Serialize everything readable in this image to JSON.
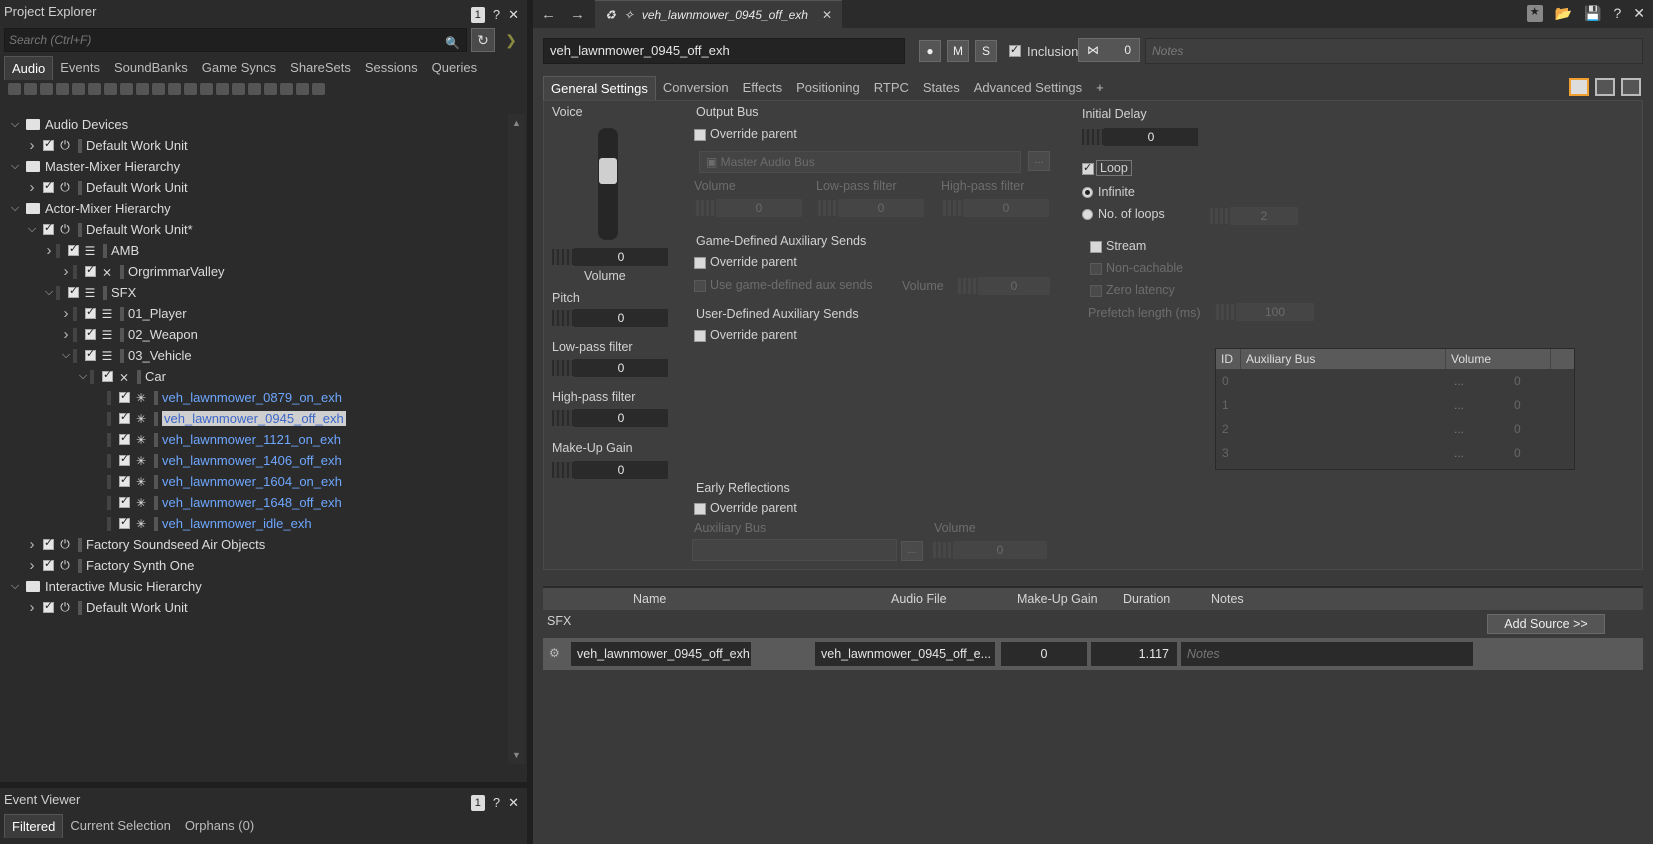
{
  "project_explorer": {
    "title": "Project Explorer",
    "badge": "1",
    "help": "?",
    "close": "✕",
    "search_placeholder": "Search (Ctrl+F)",
    "tabs": [
      "Audio",
      "Events",
      "SoundBanks",
      "Game Syncs",
      "ShareSets",
      "Sessions",
      "Queries"
    ],
    "active_tab": "Audio",
    "tree": [
      {
        "label": "Audio Devices",
        "level": 0,
        "kind": "folder"
      },
      {
        "label": "Default Work Unit",
        "level": 1,
        "kind": "wu"
      },
      {
        "label": "Master-Mixer Hierarchy",
        "level": 0,
        "kind": "folder"
      },
      {
        "label": "Default Work Unit",
        "level": 1,
        "kind": "wu"
      },
      {
        "label": "Actor-Mixer Hierarchy",
        "level": 0,
        "kind": "folder"
      },
      {
        "label": "Default Work Unit*",
        "level": 1,
        "kind": "wu"
      },
      {
        "label": "AMB",
        "level": 2,
        "kind": "actor"
      },
      {
        "label": "OrgrimmarValley",
        "level": 3,
        "kind": "random"
      },
      {
        "label": "SFX",
        "level": 2,
        "kind": "actor"
      },
      {
        "label": "01_Player",
        "level": 3,
        "kind": "actor"
      },
      {
        "label": "02_Weapon",
        "level": 3,
        "kind": "actor"
      },
      {
        "label": "03_Vehicle",
        "level": 3,
        "kind": "actor"
      },
      {
        "label": "Car",
        "level": 4,
        "kind": "random"
      },
      {
        "label": "veh_lawnmower_0879_on_exh",
        "level": 5,
        "kind": "sound"
      },
      {
        "label": "veh_lawnmower_0945_off_exh",
        "level": 5,
        "kind": "sound",
        "selected": true
      },
      {
        "label": "veh_lawnmower_1121_on_exh",
        "level": 5,
        "kind": "sound"
      },
      {
        "label": "veh_lawnmower_1406_off_exh",
        "level": 5,
        "kind": "sound"
      },
      {
        "label": "veh_lawnmower_1604_on_exh",
        "level": 5,
        "kind": "sound"
      },
      {
        "label": "veh_lawnmower_1648_off_exh",
        "level": 5,
        "kind": "sound"
      },
      {
        "label": "veh_lawnmower_idle_exh",
        "level": 5,
        "kind": "sound"
      },
      {
        "label": "Factory Soundseed Air Objects",
        "level": 1,
        "kind": "wu"
      },
      {
        "label": "Factory Synth One",
        "level": 1,
        "kind": "wu"
      },
      {
        "label": "Interactive Music Hierarchy",
        "level": 0,
        "kind": "folder"
      },
      {
        "label": "Default Work Unit",
        "level": 1,
        "kind": "wu"
      }
    ]
  },
  "event_viewer": {
    "title": "Event Viewer",
    "badge": "1",
    "tabs": [
      "Filtered",
      "Current Selection",
      "Orphans (0)"
    ]
  },
  "editor": {
    "tab_title": "veh_lawnmower_0945_off_exh",
    "name": "veh_lawnmower_0945_off_exh",
    "m_label": "M",
    "s_label": "S",
    "inclusion_label": "Inclusion",
    "share_count": "0",
    "notes_placeholder": "Notes",
    "tabs": [
      "General Settings",
      "Conversion",
      "Effects",
      "Positioning",
      "RTPC",
      "States",
      "Advanced Settings",
      "+"
    ],
    "active_tab": "General Settings"
  },
  "general": {
    "voice_label": "Voice",
    "volume_value": "0",
    "volume_label": "Volume",
    "pitch_label": "Pitch",
    "pitch_value": "0",
    "lpf_label": "Low-pass filter",
    "lpf_value": "0",
    "hpf_label": "High-pass filter",
    "hpf_value": "0",
    "makeup_label": "Make-Up Gain",
    "makeup_value": "0",
    "output_bus_label": "Output Bus",
    "override_parent": "Override parent",
    "master_audio_bus": "Master Audio Bus",
    "ob_volume": "Volume",
    "ob_lpf": "Low-pass filter",
    "ob_hpf": "High-pass filter",
    "ob_volume_val": "0",
    "ob_lpf_val": "0",
    "ob_hpf_val": "0",
    "gda_label": "Game-Defined Auxiliary Sends",
    "use_game_aux": "Use game-defined aux sends",
    "gda_volume": "Volume",
    "gda_volume_val": "0",
    "uda_label": "User-Defined Auxiliary Sends",
    "aux_cols": [
      "ID",
      "Auxiliary Bus",
      "Volume"
    ],
    "aux_rows": [
      "0",
      "1",
      "2",
      "3"
    ],
    "aux_vals": [
      "0",
      "0",
      "0",
      "0"
    ],
    "er_label": "Early Reflections",
    "er_aux_bus": "Auxiliary Bus",
    "er_volume": "Volume",
    "er_volume_val": "0",
    "initial_delay_label": "Initial Delay",
    "initial_delay_val": "0",
    "loop_label": "Loop",
    "infinite_label": "Infinite",
    "no_loops_label": "No. of loops",
    "no_loops_val": "2",
    "stream_label": "Stream",
    "non_cachable": "Non-cachable",
    "zero_latency": "Zero latency",
    "prefetch_label": "Prefetch length (ms)",
    "prefetch_val": "100"
  },
  "sources": {
    "cols": [
      "Name",
      "Audio File",
      "Make-Up Gain",
      "Duration",
      "Notes"
    ],
    "group": "SFX",
    "add_source": "Add Source >>",
    "row": {
      "name": "veh_lawnmower_0945_off_exh",
      "audio_file": "veh_lawnmower_0945_off_e...",
      "makeup_gain": "0",
      "duration": "1.117",
      "notes_placeholder": "Notes"
    }
  }
}
